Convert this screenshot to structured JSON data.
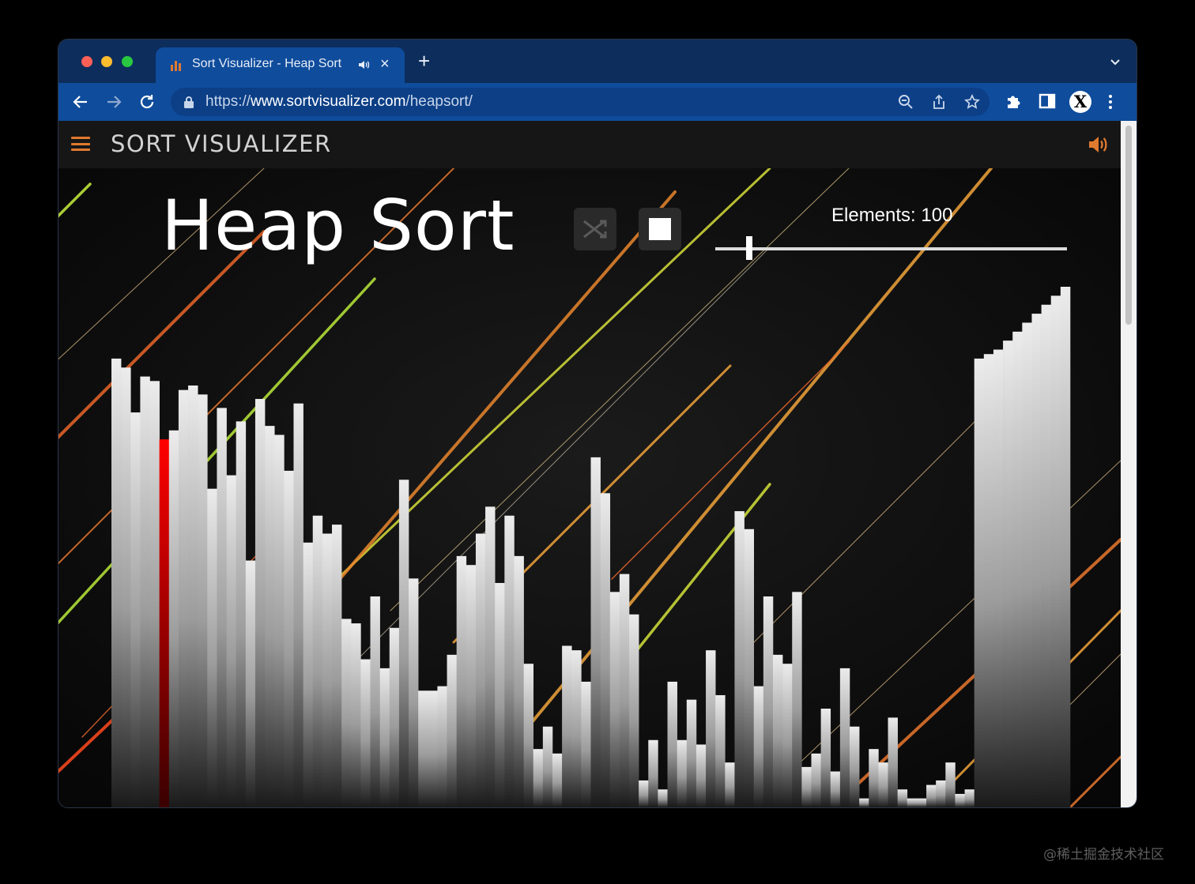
{
  "browser": {
    "tab_title": "Sort Visualizer - Heap Sort",
    "tab_close": "×",
    "new_tab": "+",
    "url_scheme": "https://",
    "url_host": "www.sortvisualizer.com",
    "url_path": "/heapsort/",
    "profile_initial": "X"
  },
  "app": {
    "brand": "SORT VISUALIZER",
    "page_title": "Heap Sort",
    "elements_label": "Elements: 100",
    "accent_color": "#e07a2e",
    "highlight_color": "#e00000"
  },
  "controls": {
    "elements_count": 100,
    "elements_slider_fraction": 0.1
  },
  "visualization": {
    "array_values": [
      100,
      98,
      88,
      96,
      95,
      82,
      84,
      93,
      94,
      92,
      71,
      89,
      74,
      86,
      55,
      91,
      85,
      83,
      75,
      90,
      59,
      65,
      61,
      63,
      42,
      41,
      33,
      47,
      31,
      40,
      73,
      51,
      26,
      26,
      27,
      34,
      56,
      54,
      61,
      67,
      50,
      65,
      56,
      32,
      13,
      18,
      12,
      36,
      35,
      28,
      78,
      70,
      48,
      52,
      43,
      6,
      15,
      4,
      28,
      15,
      24,
      14,
      35,
      25,
      10,
      66,
      62,
      27,
      47,
      34,
      32,
      48,
      9,
      12,
      22,
      8,
      31,
      18,
      2,
      13,
      10,
      20,
      4,
      2,
      2,
      5,
      6,
      10,
      3,
      4,
      100,
      101,
      102,
      104,
      106,
      108,
      110,
      112,
      114,
      116
    ],
    "highlight_index": 5,
    "sorted_from_index": 90
  },
  "footer": {
    "watermark": "@稀土掘金技术社区"
  }
}
